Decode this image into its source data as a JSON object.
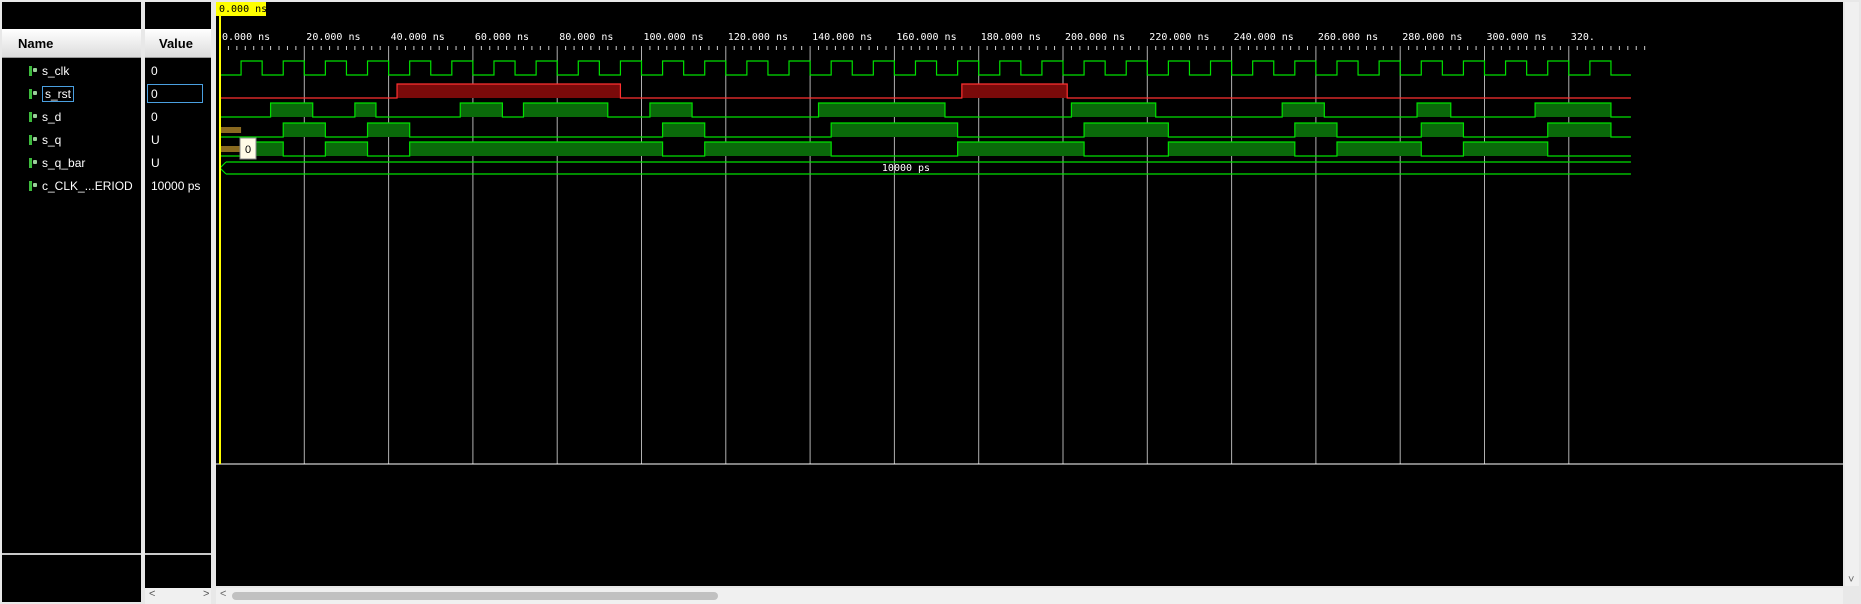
{
  "columns": {
    "name": "Name",
    "value": "Value"
  },
  "signals": [
    {
      "name": "s_clk",
      "value": "0"
    },
    {
      "name": "s_rst",
      "value": "0"
    },
    {
      "name": "s_d",
      "value": "0"
    },
    {
      "name": "s_q",
      "value": "U"
    },
    {
      "name": "s_q_bar",
      "value": "U"
    },
    {
      "name": "c_CLK_...ERIOD",
      "value": "10000 ps"
    }
  ],
  "cursor": {
    "label": "0.000 ns",
    "tooltip": "0"
  },
  "timeline": {
    "ticks": [
      "0.000 ns",
      "20.000 ns",
      "40.000 ns",
      "60.000 ns",
      "80.000 ns",
      "100.000 ns",
      "120.000 ns",
      "140.000 ns",
      "160.000 ns",
      "180.000 ns",
      "200.000 ns",
      "220.000 ns",
      "240.000 ns",
      "260.000 ns",
      "280.000 ns",
      "300.000 ns",
      "320."
    ]
  },
  "period_bus_label": "10000 ps",
  "waveforms": {
    "s_clk_period_ns": 10,
    "s_rst_high": [
      [
        42,
        95
      ],
      [
        176,
        201
      ]
    ],
    "s_d_high": [
      [
        12,
        22
      ],
      [
        32,
        37
      ],
      [
        57,
        67
      ],
      [
        72,
        92
      ],
      [
        102,
        112
      ],
      [
        142,
        172
      ],
      [
        202,
        222
      ],
      [
        252,
        262
      ],
      [
        284,
        292
      ],
      [
        312,
        330
      ]
    ],
    "s_q_high": [
      [
        15,
        25
      ],
      [
        35,
        45
      ],
      [
        105,
        115
      ],
      [
        145,
        175
      ],
      [
        205,
        225
      ],
      [
        255,
        265
      ],
      [
        285,
        295
      ],
      [
        315,
        330
      ]
    ],
    "s_q_bar_high": [
      [
        5,
        15
      ],
      [
        25,
        35
      ],
      [
        45,
        105
      ],
      [
        115,
        145
      ],
      [
        175,
        205
      ],
      [
        225,
        255
      ],
      [
        265,
        285
      ],
      [
        295,
        315
      ]
    ],
    "undefined_until_ns": 5,
    "colors": {
      "wave": "#00e000",
      "fill": "#0a6a0a",
      "rst": "#ff3030",
      "rst_fill": "#7a0a0a",
      "cursor": "#ffff00",
      "grid": "#b0b0b0"
    }
  },
  "scroll_arrows": {
    "left": "<",
    "right": ">"
  }
}
